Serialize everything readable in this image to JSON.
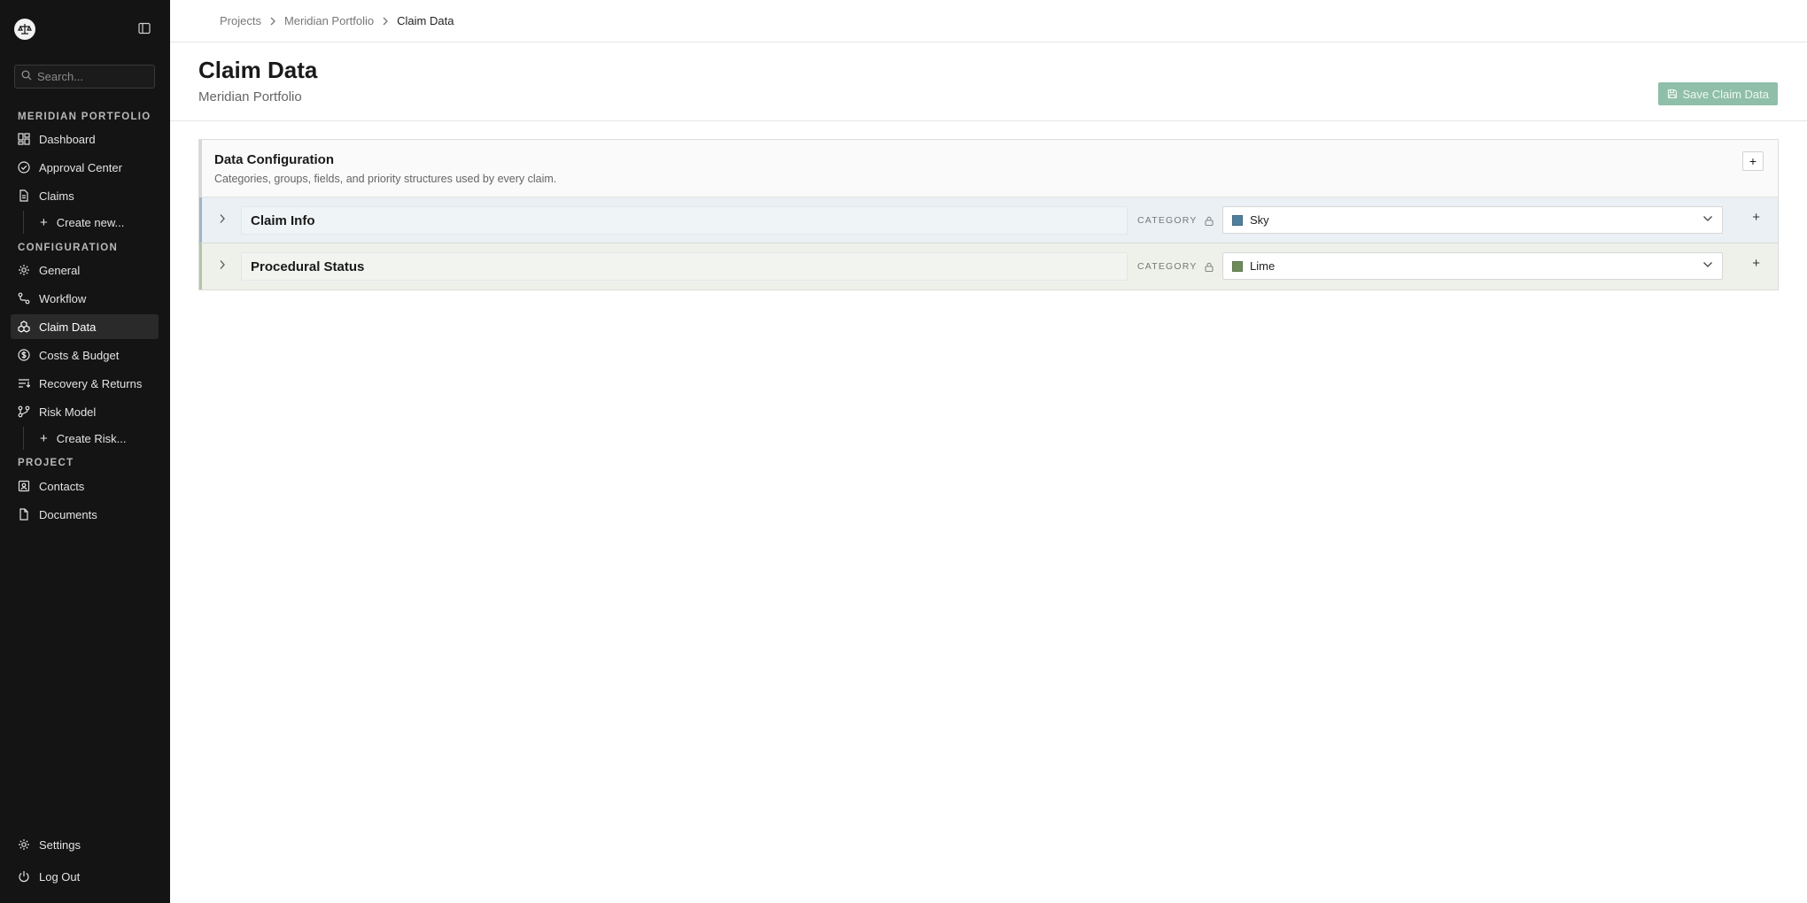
{
  "sidebar": {
    "search_placeholder": "Search...",
    "sections": {
      "portfolio": "MERIDIAN PORTFOLIO",
      "configuration": "CONFIGURATION",
      "project": "PROJECT"
    },
    "items": {
      "dashboard": "Dashboard",
      "approval_center": "Approval Center",
      "claims": "Claims",
      "create_new": "Create new...",
      "general": "General",
      "workflow": "Workflow",
      "claim_data": "Claim Data",
      "costs_budget": "Costs & Budget",
      "recovery_returns": "Recovery & Returns",
      "risk_model": "Risk Model",
      "create_risk": "Create Risk...",
      "contacts": "Contacts",
      "documents": "Documents",
      "settings": "Settings",
      "log_out": "Log Out"
    }
  },
  "breadcrumb": [
    "Projects",
    "Meridian Portfolio",
    "Claim Data"
  ],
  "header": {
    "title": "Claim Data",
    "subtitle": "Meridian Portfolio",
    "save_label": "Save Claim Data"
  },
  "config": {
    "title": "Data Configuration",
    "description": "Categories, groups, fields, and priority structures used by every claim.",
    "add_symbol": "+",
    "categories": [
      {
        "name": "Claim Info",
        "label": "CATEGORY",
        "color_name": "Sky",
        "color": "#4f7f9c"
      },
      {
        "name": "Procedural Status",
        "label": "CATEGORY",
        "color_name": "Lime",
        "color": "#6e8c5a"
      }
    ]
  },
  "colors": {
    "sidebar_bg": "#141414",
    "accent_save": "#8fbfa9",
    "sky_row": "#eaf0f4",
    "lime_row": "#edf1ea"
  }
}
